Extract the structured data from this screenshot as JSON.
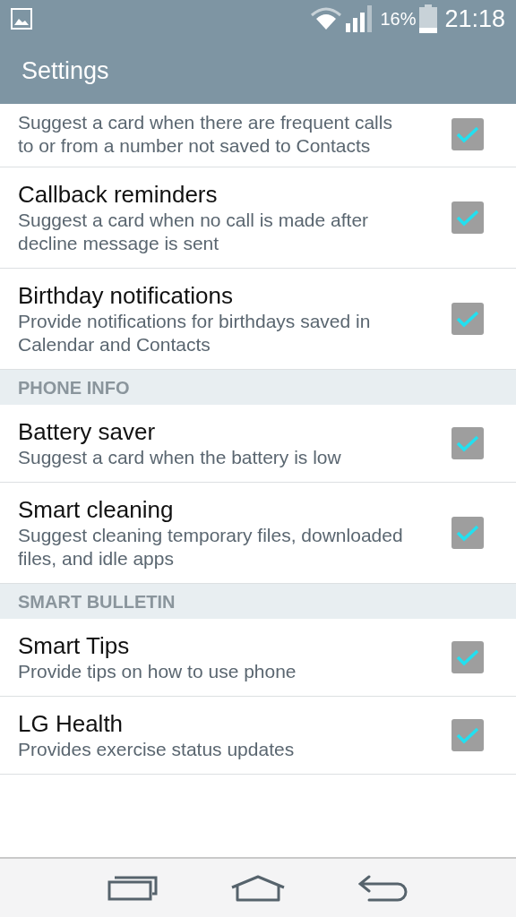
{
  "status_bar": {
    "battery_percent": "16%",
    "time": "21:18"
  },
  "app_bar": {
    "title": "Settings"
  },
  "list": [
    {
      "kind": "setting",
      "description": "Suggest a card when there are frequent calls to or from a number not saved to Contacts",
      "checked": true
    },
    {
      "kind": "setting",
      "title": "Callback reminders",
      "description": "Suggest a card when no call is made after decline message is sent",
      "checked": true
    },
    {
      "kind": "setting",
      "title": "Birthday notifications",
      "description": "Provide notifications for birthdays saved in Calendar and Contacts",
      "checked": true
    },
    {
      "kind": "header",
      "title": "PHONE INFO"
    },
    {
      "kind": "setting",
      "title": "Battery saver",
      "description": "Suggest a card when the battery is low",
      "checked": true
    },
    {
      "kind": "setting",
      "title": "Smart cleaning",
      "description": "Suggest cleaning temporary files, downloaded files, and idle apps",
      "checked": true
    },
    {
      "kind": "header",
      "title": "SMART BULLETIN"
    },
    {
      "kind": "setting",
      "title": "Smart Tips",
      "description": "Provide tips on how to use phone",
      "checked": true
    },
    {
      "kind": "setting",
      "title": "LG Health",
      "description": "Provides exercise status updates",
      "checked": true
    }
  ]
}
